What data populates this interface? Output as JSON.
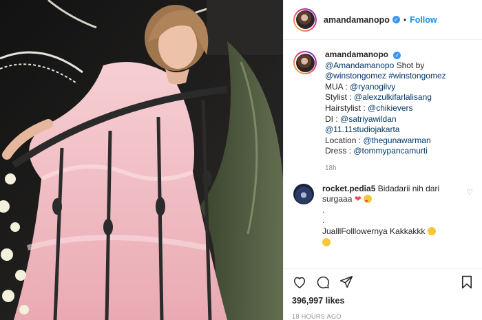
{
  "post": {
    "image_alt": "Woman in pink tulle dress on a spiral staircase",
    "colors": {
      "dress": "#f2c3c9",
      "railing": "#2a2a2a",
      "background": "#1e1d1c",
      "accent": "#0095f6"
    }
  },
  "header": {
    "username": "amandamanopo",
    "separator": "•",
    "follow_label": "Follow"
  },
  "caption": {
    "username": "amandamanopo",
    "lines": {
      "l1_tag": "@Amandamanopo",
      "l1_rest": " Shot by",
      "l2_tag1": "@winstongomez",
      "l2_tag2": "#winstongomez",
      "mua_label": "MUA : ",
      "mua_tag": "@ryanogilvy",
      "stylist_label": "Stylist : ",
      "stylist_tag": "@alexzulkifarlalisang",
      "hair_label": "Hairstylist : ",
      "hair_tag": "@chikievers",
      "di_label": "DI : ",
      "di_tag": "@satriyawildan",
      "studio_tag": "@11.11studiojakarta",
      "location_label": "Location : ",
      "location_tag": "@thegunawarman",
      "dress_label": "Dress : ",
      "dress_tag": "@tommypancamurti"
    },
    "timestamp": "18h"
  },
  "reply": {
    "username": "rocket.pedia5",
    "text1": "Bidadarii nih dari surgaaa",
    "dot1": ".",
    "dot2": ".",
    "text2": "JualllFolllowernya Kakkakkk"
  },
  "actions": {
    "likes": "396,997 likes",
    "time": "18 HOURS AGO"
  }
}
